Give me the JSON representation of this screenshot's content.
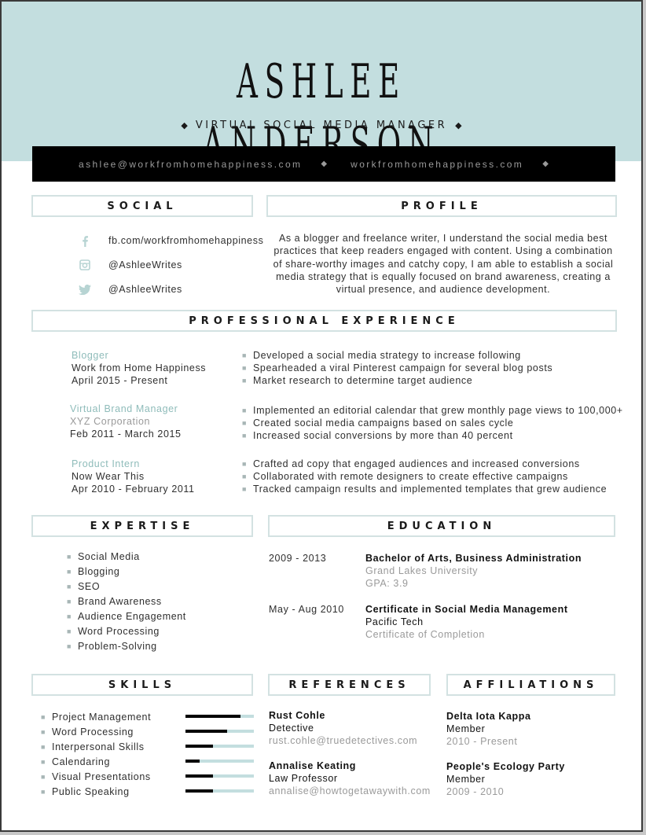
{
  "header": {
    "name": "ASHLEE ANDERSON",
    "title": "VIRTUAL SOCIAL MEDIA MANAGER",
    "diamond": "◆",
    "email": "ashlee@workfromhomehappiness.com",
    "website": "workfromhomehappiness.com"
  },
  "colors": {
    "band": "#c3dedf",
    "accent": "#8fbcba",
    "contact_bar": "#000000",
    "box_border": "#d3e2e2"
  },
  "social": {
    "heading": "SOCIAL",
    "items": [
      {
        "icon": "facebook-icon",
        "text": "fb.com/workfromhomehappiness"
      },
      {
        "icon": "instagram-icon",
        "text": "@AshleeWrites"
      },
      {
        "icon": "twitter-icon",
        "text": "@AshleeWrites"
      }
    ]
  },
  "profile": {
    "heading": "PROFILE",
    "text": "As a blogger and freelance writer, I understand the social media best practices that keep readers engaged with content. Using a combination of share-worthy images and catchy copy, I am able to establish a social media strategy that is equally focused on brand awareness, creating a virtual presence, and audience development."
  },
  "experience": {
    "heading": "PROFESSIONAL EXPERIENCE",
    "jobs": [
      {
        "title": "Blogger",
        "company": "Work from Home Happiness",
        "dates": "April 2015 - Present",
        "bullets": [
          "Developed a social media strategy to increase following",
          "Spearheaded a viral Pinterest campaign for several blog posts",
          "Market research to determine target audience"
        ]
      },
      {
        "title": "Virtual Brand Manager",
        "company": "XYZ Corporation",
        "dates": "Feb 2011 - March 2015",
        "bullets": [
          "Implemented an editorial calendar that grew monthly page views to 100,000+",
          "Created social media campaigns based on sales cycle",
          "Increased social conversions by more than 40 percent"
        ]
      },
      {
        "title": "Product Intern",
        "company": "Now Wear This",
        "dates": "Apr 2010 - February 2011",
        "bullets": [
          "Crafted ad copy that engaged audiences and increased conversions",
          "Collaborated with remote designers to create effective campaigns",
          "Tracked campaign results and implemented templates that grew audience"
        ]
      }
    ]
  },
  "expertise": {
    "heading": "EXPERTISE",
    "items": [
      "Social Media",
      "Blogging",
      "SEO",
      "Brand Awareness",
      "Audience Engagement",
      "Word Processing",
      "Problem-Solving"
    ]
  },
  "education": {
    "heading": "EDUCATION",
    "entries": [
      {
        "dates": "2009 - 2013",
        "degree": "Bachelor of Arts, Business Administration",
        "school": "Grand Lakes University",
        "detail": "GPA: 3.9"
      },
      {
        "dates": "May - Aug 2010",
        "degree": "Certificate in Social Media Management",
        "school": "Pacific Tech",
        "detail": "Certificate of Completion"
      }
    ]
  },
  "skills": {
    "heading": "SKILLS",
    "items": [
      {
        "name": "Project Management",
        "level": 0.8
      },
      {
        "name": "Word Processing",
        "level": 0.61
      },
      {
        "name": "Interpersonal Skills",
        "level": 0.4
      },
      {
        "name": "Calendaring",
        "level": 0.21
      },
      {
        "name": "Visual Presentations",
        "level": 0.4
      },
      {
        "name": "Public Speaking",
        "level": 0.4
      }
    ]
  },
  "references": {
    "heading": "REFERENCES",
    "people": [
      {
        "name": "Rust Cohle",
        "role": "Detective",
        "email": "rust.cohle@truedetectives.com"
      },
      {
        "name": "Annalise Keating",
        "role": "Law Professor",
        "email": "annalise@howtogetawaywith.com"
      }
    ]
  },
  "affiliations": {
    "heading": "AFFILIATIONS",
    "orgs": [
      {
        "name": "Delta Iota Kappa",
        "role": "Member",
        "dates": "2010 - Present"
      },
      {
        "name": "People's Ecology Party",
        "role": "Member",
        "dates": "2009 - 2010"
      }
    ]
  }
}
